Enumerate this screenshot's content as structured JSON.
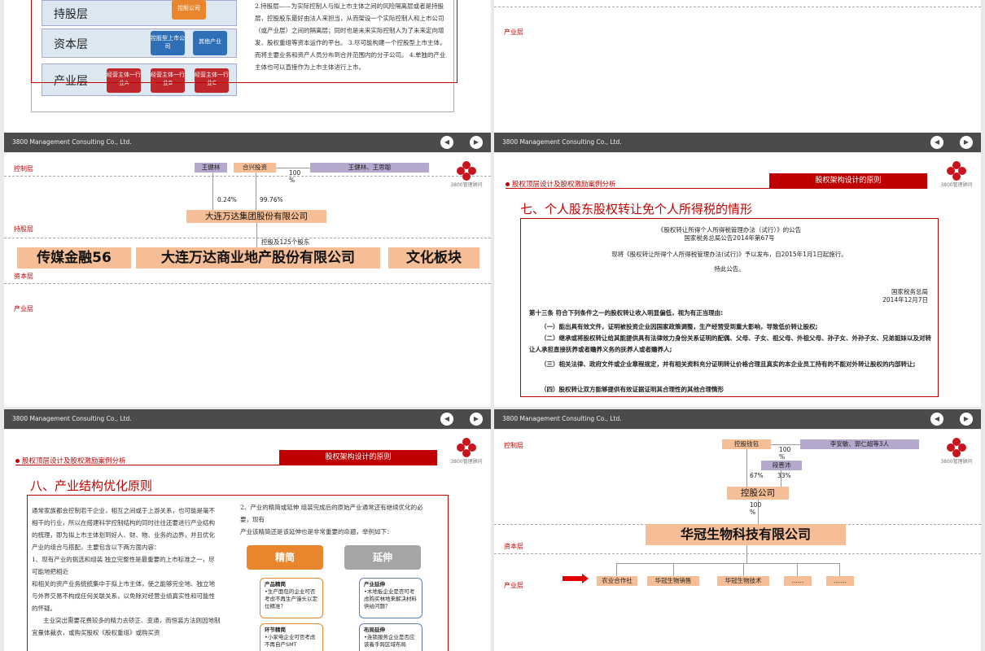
{
  "footer": {
    "company": "3800 Management Consulting Co., Ltd.",
    "prev": "◀",
    "next": "▶"
  },
  "logo": {
    "name": "3800管理顾问",
    "sub": "3800 Management Consulting Co., Ltd."
  },
  "slide1": {
    "layers": [
      "持股层",
      "资本层",
      "产业层"
    ],
    "holding_box": "控股公司",
    "capital_boxes": [
      "控股型上市公司",
      "其他产业"
    ],
    "industry_boxes": [
      "经营主体一行业A",
      "经营主体一行业B",
      "经营主体一行业C"
    ],
    "text": "2.持股层——为实际控制人与拟上市主体之间的风险隔离层或者是持股层，控股股东最好由法人来担当，从而架设一个实际控制人和上市公司（或产业层）之间的隔离层；同时也是未来实际控制人为了未来定向增发、股权重组等资本运作的平台。 3.尽可能构建一个控股型上市主体，而将主要业务和资产人员分布到合并范围内的分子公司。 4.单独的产业主体也可以直接作为上市主体进行上市。"
  },
  "slide2": {
    "layer": "产业层"
  },
  "slide3": {
    "layers": [
      "控制层",
      "持股层",
      "资本层",
      "产业层"
    ],
    "top_tags": [
      "王健林",
      "合兴投资",
      "王健林、王思聪"
    ],
    "pct_100": "100\n%",
    "pct_left": "0.24%",
    "pct_right": "99.76%",
    "group": "大连万达集团股份有限公司",
    "holding_note": "控股及125个股东",
    "capital": [
      "传媒金融56",
      "大连万达商业地产股份有限公司",
      "文化板块"
    ]
  },
  "slide4": {
    "section": "股权顶层设计及股权激励案例分析",
    "header": "股权架构设计的原则",
    "title": "七、个人股东股权转让免个人所得税的情形",
    "notice_title": "《股权转让所得个人所得税管理办法（试行）》的公告",
    "notice_no": "国家税务总局公告2014年第67号",
    "notice_body": "现将《股权转让所得个人所得税管理办法(试行)》予以发布，自2015年1月1日起施行。",
    "notice_end": "特此公告。",
    "issuer": "国家税务总局",
    "date": "2014年12月7日",
    "article": "第十三条 符合下列条件之一的股权转让收入明显偏低，视为有正当理由:",
    "items": [
      "（一）能出具有效文件，证明被投资企业因国家政策调整，生产经营受到重大影响，导致低价转让股权;",
      "（二）继承或将股权转让给其能提供具有法律效力身份关系证明的配偶、父母、子女、祖父母、外祖父母、孙子女、外孙子女、兄弟姐妹以及对转让人承担直接抚养或者赡养义务的抚养人或者赡养人;",
      "（三）相关法律、政府文件或企业章程规定，并有相关资料充分证明转让价格合理且真实的本企业员工持有的不能对外转让股权的内部转让;",
      "（四）股权转让双方能够提供有效证据证明其合理性的其他合理情形"
    ]
  },
  "slide5": {
    "section": "股权顶层设计及股权激励案例分析",
    "header": "股权架构设计的原则",
    "title": "八、产业结构优化原则",
    "left_text": [
      "通常家族都会控制若干企业，相互之间或于上游关系，也可能是毫不相干的行业，所以在搭建科学控制结构的同时往往还要进行产业结构的梳理，即为拟上市主体划到好人、财、物、业务的边界，并且优化产业的组合与搭配，主要包含以下两方面内容：",
      "1、现有产业的挑选和组装 独立完整性是最重要的上市标准之一，尽可能地把相近",
      "和相关的资产业务统统集中于拟上市主体，使之能够完全地、独立地与外界交易不构成任何关联关系，以免除对经营业绩真实性和可能性的怀疑。",
      "主业突出需要花费较多的精力去矫正、变通，而恒装方法则因地制宜量体裁衣，或购买股权《股权重组》或购买资"
    ],
    "right_text": [
      "2、产业的精简或延伸 组装完成后的原始产业通常还有继续优化的必要，现有",
      "产业该精简还是该延伸也是非常重要的命题，举例如下："
    ],
    "btn_left": "精简",
    "btn_right": "延伸",
    "cards_left": [
      {
        "title": "产品精简",
        "body": "•生产面包的企业可否考虑不再生产馒头以定位精准？"
      },
      {
        "title": "环节精简",
        "body": "•小家电企业可否考虑不再自产SMT"
      }
    ],
    "cards_right": [
      {
        "title": "产业延伸",
        "body": "•木地板企业是否可考虑购买林地来解决材料供给问题？"
      },
      {
        "title": "布局延伸",
        "body": "•连锁服务企业是否应该着手跨区域布局"
      }
    ]
  },
  "slide6": {
    "layers": [
      "控制层",
      "资本层",
      "产业层"
    ],
    "top_left": "控股钱包",
    "top_right": "李安敏、郭仁超等3人",
    "pct_100a": "100\n%",
    "mid_tag": "段晋沛",
    "pct_67": "67%",
    "pct_33": "33%",
    "holding": "控股公司",
    "pct_100b": "100\n%",
    "company": "华冠生物科技有限公司",
    "subs": [
      "农业合作社",
      "华冠生物销售",
      "华冠生物技术",
      "……",
      "……"
    ]
  }
}
